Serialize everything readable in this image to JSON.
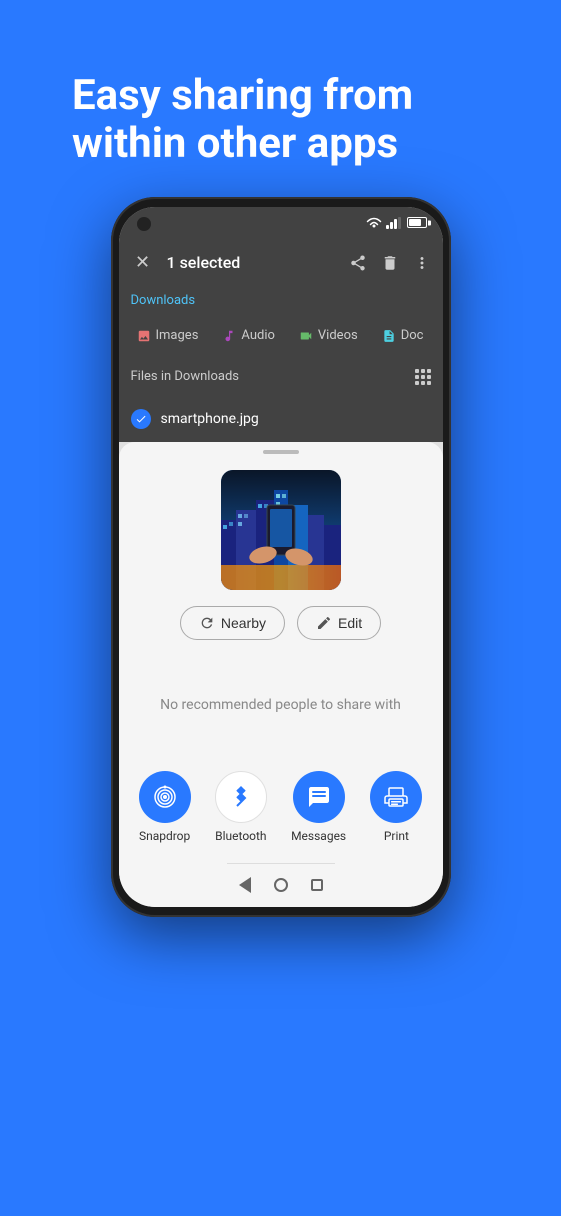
{
  "headline": {
    "line1": "Easy sharing from",
    "line2": "within other apps"
  },
  "phone": {
    "status_bar": {
      "wifi": "wifi",
      "signal": "signal",
      "battery": "battery"
    },
    "toolbar": {
      "close_icon": "✕",
      "title": "1 selected",
      "share_icon": "share",
      "delete_icon": "delete",
      "more_icon": "more"
    },
    "breadcrumb": "Downloads",
    "categories": [
      {
        "label": "Images",
        "icon": "🖼"
      },
      {
        "label": "Audio",
        "icon": "🎵"
      },
      {
        "label": "Videos",
        "icon": "🎬"
      },
      {
        "label": "Doc",
        "icon": "📄"
      }
    ],
    "files_header": "Files in Downloads",
    "file_item": {
      "name": "smartphone.jpg",
      "selected": true
    },
    "bottom_sheet": {
      "handle": true,
      "image_alt": "smartphone photo preview",
      "action_buttons": [
        {
          "label": "Nearby",
          "icon": "nearby"
        },
        {
          "label": "Edit",
          "icon": "edit"
        }
      ],
      "no_recommend_text": "No recommended people to share with",
      "share_apps": [
        {
          "label": "Snapdrop",
          "icon": "snapdrop",
          "color": "#2979FF"
        },
        {
          "label": "Bluetooth",
          "icon": "bluetooth",
          "color": "white"
        },
        {
          "label": "Messages",
          "icon": "messages",
          "color": "#2979FF"
        },
        {
          "label": "Print",
          "icon": "print",
          "color": "#2979FF"
        }
      ]
    },
    "nav_bar": {
      "back": "◀",
      "home": "○",
      "recent": "□"
    }
  }
}
